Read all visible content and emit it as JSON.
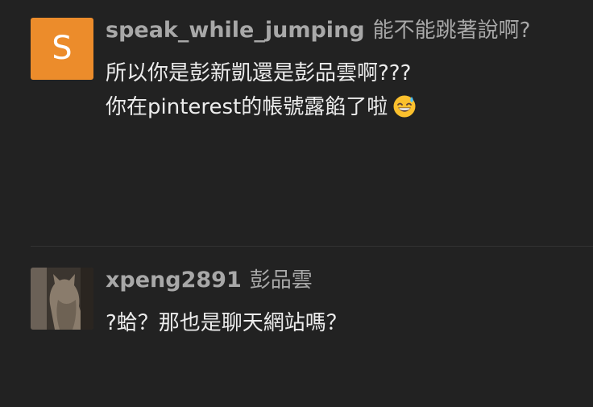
{
  "comments": [
    {
      "avatar_letter": "S",
      "username": "speak_while_jumping",
      "nickname": "能不能跳著說啊?",
      "lines": [
        "所以你是彭新凱還是彭品雲啊???",
        "你在pinterest的帳號露餡了啦"
      ],
      "emoji": "grinning-face-with-sweat-icon"
    },
    {
      "avatar": "cat-photo",
      "username": "xpeng2891",
      "nickname": "彭品雲",
      "lines": [
        "?蛤？那也是聊天網站嗎？"
      ]
    }
  ],
  "colors": {
    "background": "#222222",
    "avatar_orange": "#ec8c2b",
    "username_gray": "#a8a8a8",
    "text": "#ececec"
  }
}
